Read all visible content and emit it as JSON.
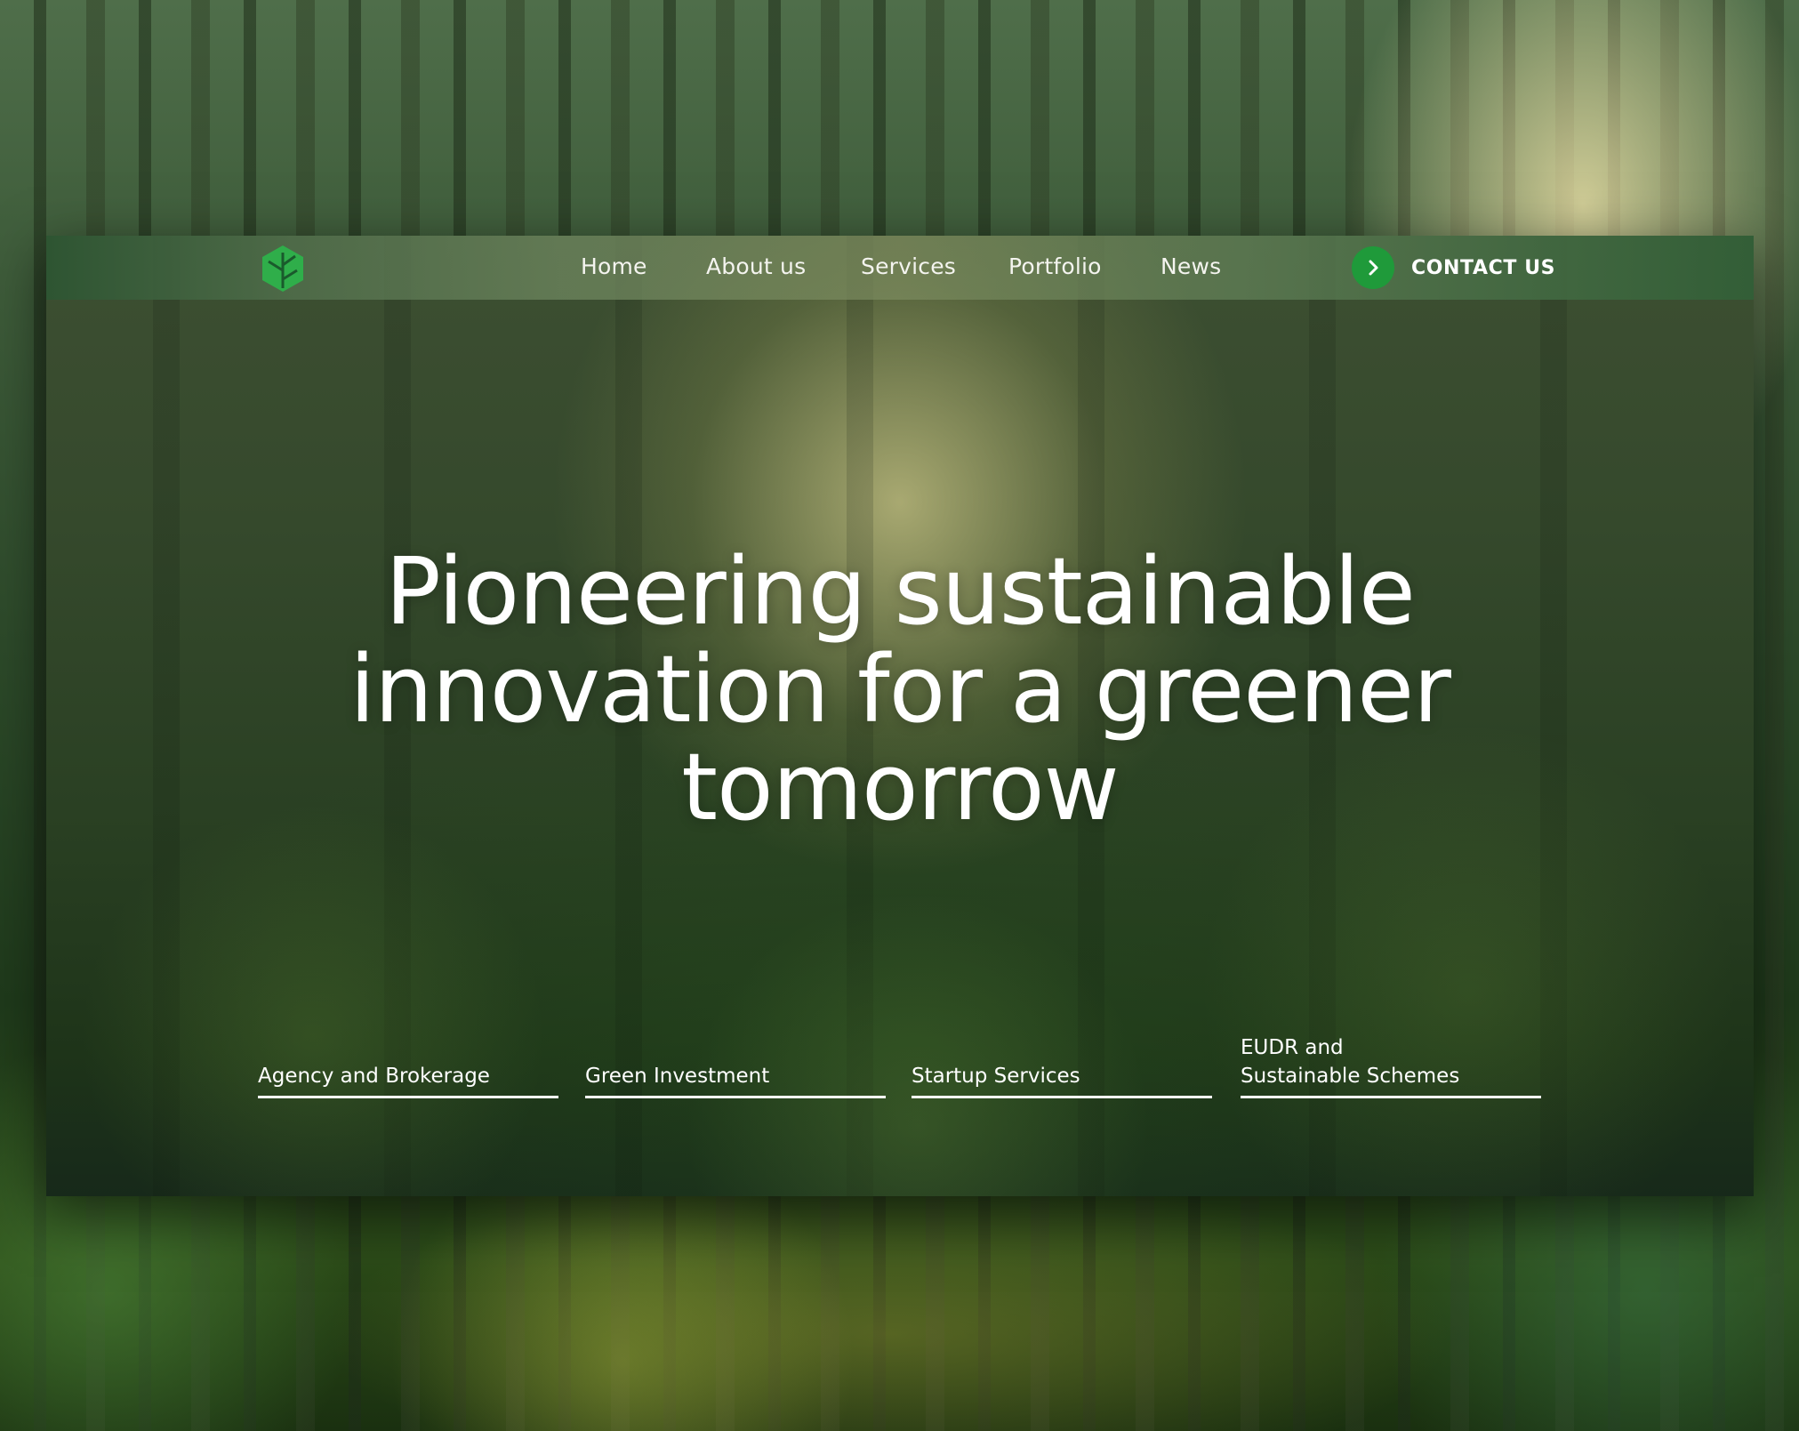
{
  "nav": {
    "logo_icon": "leaf-hexagon-icon",
    "links": [
      {
        "label": "Home"
      },
      {
        "label": "About us"
      },
      {
        "label": "Services"
      },
      {
        "label": "Portfolio"
      },
      {
        "label": "News"
      }
    ],
    "contact": {
      "label": "CONTACT US",
      "icon": "chevron-right-icon"
    }
  },
  "hero": {
    "title": "Pioneering sustainable innovation for a greener tomorrow"
  },
  "services": [
    {
      "label": "Agency and Brokerage"
    },
    {
      "label": "Green Investment"
    },
    {
      "label": "Startup Services"
    },
    {
      "label": "EUDR and\nSustainable Schemes"
    }
  ],
  "colors": {
    "accent": "#1f9a3a",
    "logo_green": "#2fae4a"
  }
}
